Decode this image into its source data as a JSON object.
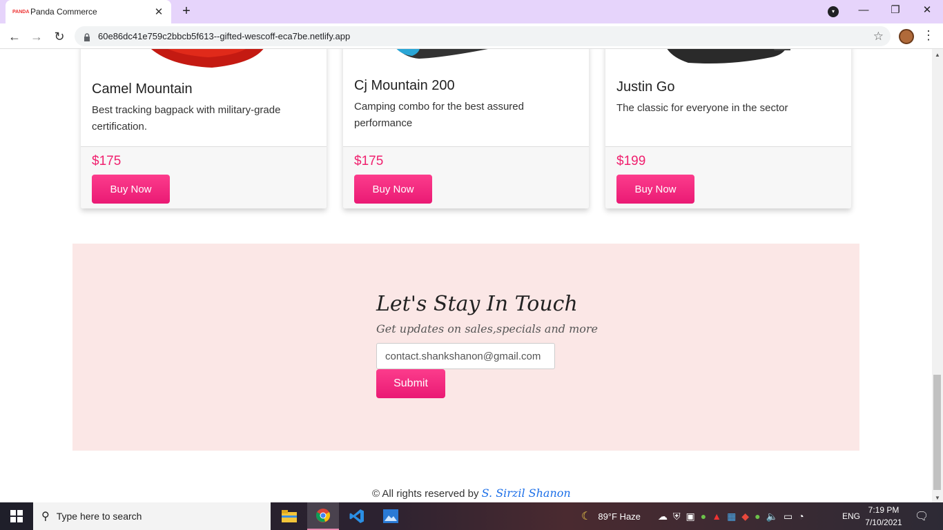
{
  "browser": {
    "tab_title": "Panda Commerce",
    "tab_close": "✕",
    "new_tab": "+",
    "url": "60e86dc41e759c2bbcb5f613--gifted-wescoff-eca7be.netlify.app",
    "favicon_text": "PANDA"
  },
  "products": [
    {
      "name": "Camel Mountain",
      "description": "Best tracking bagpack with military-grade certification.",
      "price": "$175",
      "buy_label": "Buy Now"
    },
    {
      "name": "Cj Mountain 200",
      "description": "Camping combo for the best assured performance",
      "price": "$175",
      "buy_label": "Buy Now"
    },
    {
      "name": "Justin Go",
      "description": "The classic for everyone in the sector",
      "price": "$199",
      "buy_label": "Buy Now"
    }
  ],
  "newsletter": {
    "title": "Let's Stay In Touch",
    "subtitle": "Get updates on sales,specials and more",
    "email_value": "contact.shankshanon@gmail.com",
    "submit_label": "Submit"
  },
  "footer": {
    "text": "© All rights reserved by",
    "author": "S. Sirzil Shanon"
  },
  "taskbar": {
    "search_placeholder": "Type here to search",
    "weather": "89°F  Haze",
    "language": "ENG",
    "time": "7:19 PM",
    "date": "7/10/2021"
  },
  "colors": {
    "accent": "#f0206e",
    "newsletter_bg": "#fbe7e6",
    "tabstrip_bg": "#e6d4fb",
    "author_link": "#1a6ee8"
  }
}
